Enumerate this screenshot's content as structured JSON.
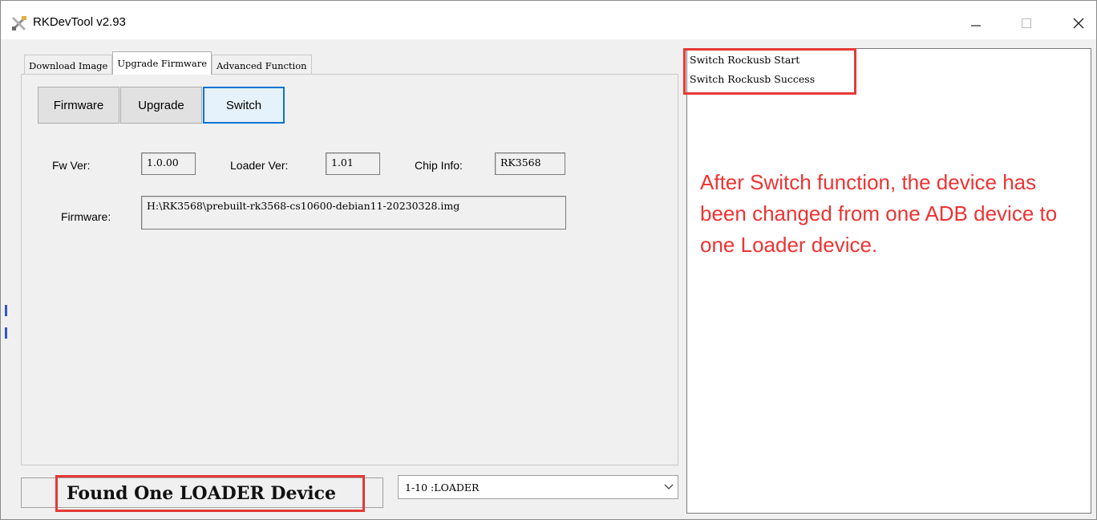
{
  "window": {
    "title": "RKDevTool v2.93",
    "icons": {
      "app": "tools-icon",
      "minimize": "minimize-icon",
      "maximize": "maximize-icon",
      "close": "close-icon"
    }
  },
  "tabs": [
    {
      "label": "Download Image",
      "active": false
    },
    {
      "label": "Upgrade Firmware",
      "active": true
    },
    {
      "label": "Advanced Function",
      "active": false
    }
  ],
  "toolbar": {
    "firmware_label": "Firmware",
    "upgrade_label": "Upgrade",
    "switch_label": "Switch"
  },
  "info": {
    "fw_ver_label": "Fw Ver:",
    "fw_ver_value": "1.0.00",
    "loader_ver_label": "Loader Ver:",
    "loader_ver_value": "1.01",
    "chip_info_label": "Chip Info:",
    "chip_info_value": "RK3568",
    "firmware_label": "Firmware:",
    "firmware_path": "H:\\RK3568\\prebuilt-rk3568-cs10600-debian11-20230328.img"
  },
  "log": {
    "lines": [
      "Switch Rockusb Start",
      "Switch Rockusb Success"
    ]
  },
  "annotation": "After Switch function, the device has been changed from one ADB device to one Loader device.",
  "status": {
    "message": "Found One LOADER Device",
    "device_selected": "1-10 :LOADER"
  },
  "colors": {
    "highlight_red": "#e53935",
    "annotation_red": "#ee3333",
    "focus_blue": "#0a74d4"
  }
}
